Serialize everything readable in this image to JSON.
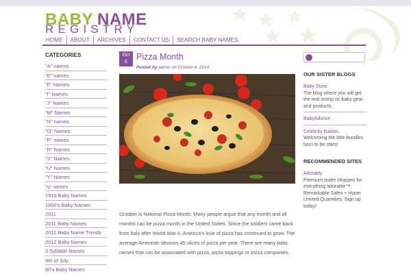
{
  "site": {
    "logo_line1_a": "BABY",
    "logo_line1_b": "NAME",
    "logo_line2": "REGISTRY"
  },
  "nav": {
    "items": [
      {
        "label": "HOME"
      },
      {
        "label": "ABOUT"
      },
      {
        "label": "ARCHIVES"
      },
      {
        "label": "CONTACT US"
      },
      {
        "label": "SEARCH BABY NAMES"
      }
    ]
  },
  "sidebar": {
    "heading": "CATEGORIES",
    "items": [
      {
        "label": "\"A\" names"
      },
      {
        "label": "\"E\" names"
      },
      {
        "label": "\"F\" Names"
      },
      {
        "label": "\"I\" Names"
      },
      {
        "label": "\"J\" Names"
      },
      {
        "label": "\"M\" Names"
      },
      {
        "label": "\"N\" names"
      },
      {
        "label": "\"O\" Names"
      },
      {
        "label": "\"P\" names"
      },
      {
        "label": "\"R\" Names"
      },
      {
        "label": "\"S\" Names"
      },
      {
        "label": "\"U\" Names"
      },
      {
        "label": "\"Y\" Names"
      },
      {
        "label": "'ry' names"
      },
      {
        "label": "1910 Baby Names"
      },
      {
        "label": "1950's Baby Names"
      },
      {
        "label": "2011"
      },
      {
        "label": "2011 Baby Names"
      },
      {
        "label": "2012 Baby Name Trends"
      },
      {
        "label": "2012 Baby Names"
      },
      {
        "label": "3 Syllable Names"
      },
      {
        "label": "4th of July"
      },
      {
        "label": "90's Baby Names"
      }
    ]
  },
  "post": {
    "date_month": "Oct",
    "date_day": "6",
    "title": "Pizza Month",
    "meta_posted_by": "Posted by",
    "meta_author": "admin",
    "meta_on": "on",
    "meta_date": "October 6, 2014",
    "body": "October is National Pizza Month.  Many people argue that any month and all months can be pizza month in the United States.  Since the soldiers came back from Italy after World War II, America's love of pizza has continued to grow.  The average American devours 45 slices of pizza per year.  There are many baby names that can be associated with pizza, pizza toppings or pizza companies."
  },
  "search": {
    "placeholder": ""
  },
  "right": {
    "sister_heading": "OUR SISTER BLOGS",
    "sister_blogs": [
      {
        "name": "Baby Store",
        "desc": "The blog where you will get the real scoop on baby gear and products."
      },
      {
        "name": "BabyAdvisor",
        "desc": ""
      },
      {
        "name": "Celebrity Babies",
        "desc": "Welcoming the little bundles born to be stars!"
      }
    ],
    "recommended_heading": "RECOMMENDED SITES",
    "recommended": [
      {
        "name": "Adorably",
        "desc": "Premium outlet shoppes for everything adorable™. Remarkable Sales + Hyper Limited Quantities. Sign up today!"
      }
    ]
  },
  "colors": {
    "brand_purple": "#8a4e9c",
    "brand_green": "#9aba3a"
  },
  "icons": {
    "search": "search-icon",
    "decor": "stars-moon-decoration-icon"
  }
}
